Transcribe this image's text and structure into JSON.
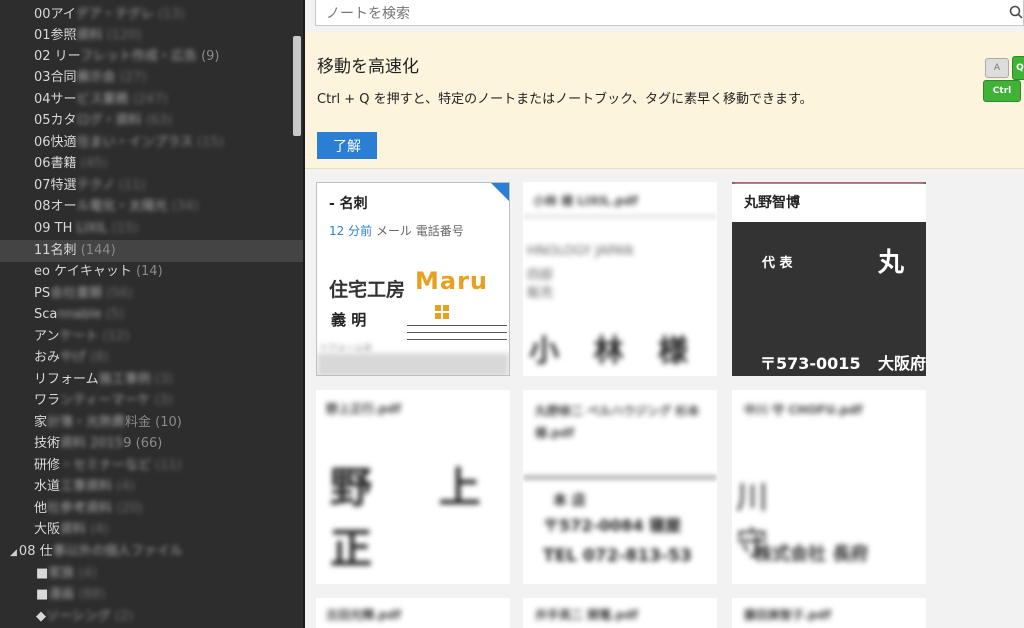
{
  "sidebar": {
    "items": [
      {
        "label": "00アイ",
        "blurred": "デア・テグレ",
        "count": "(13)"
      },
      {
        "label": "01参照",
        "blurred": "資料",
        "count": "(120)"
      },
      {
        "label": "02 リー",
        "blurred": "フレット作成・広告",
        "count": "(9)"
      },
      {
        "label": "03合同",
        "blurred": "展示会",
        "count": "(27)"
      },
      {
        "label": "04サー",
        "blurred": "ビス業務",
        "count": "(247)"
      },
      {
        "label": "05カタ",
        "blurred": "ログ・資料",
        "count": "(63)"
      },
      {
        "label": "06快適",
        "blurred": "住まい・インプラス",
        "count": "(15)"
      },
      {
        "label": "06書籍",
        "blurred": "",
        "count": "(45)"
      },
      {
        "label": "07特選",
        "blurred": "テクノ",
        "count": "(11)"
      },
      {
        "label": "08オー",
        "blurred": "ル電化・太陽光",
        "count": "(34)"
      },
      {
        "label": "09 TH",
        "blurred": "LIXIL",
        "count": "(15)"
      },
      {
        "label": "11名刺",
        "blurred": "",
        "count": "(144)"
      },
      {
        "label": "eo ケイキャット",
        "blurred": "",
        "count": "(14)"
      },
      {
        "label": "PS",
        "blurred": "会社書類",
        "count": "(56)"
      },
      {
        "label": "Sca",
        "blurred": "nnable",
        "count": "(5)"
      },
      {
        "label": "アン",
        "blurred": "ケート",
        "count": "(12)"
      },
      {
        "label": "おみ",
        "blurred": "やげ",
        "count": "(8)"
      },
      {
        "label": "リフォーム",
        "blurred": "施工事例",
        "count": "(3)"
      },
      {
        "label": "ワラ",
        "blurred": "ンティーマーケ",
        "count": "(3)"
      },
      {
        "label": "家",
        "blurred": "計簿・光熱費",
        "count": "料金 (10)"
      },
      {
        "label": "技術",
        "blurred": "資料 2015",
        "count": "9 (66)"
      },
      {
        "label": "研修",
        "blurred": "・セミナーなど",
        "count": "(11)"
      },
      {
        "label": "水道",
        "blurred": "工事資料",
        "count": "(4)"
      },
      {
        "label": "他",
        "blurred": "社参考資料",
        "count": "(20)"
      },
      {
        "label": "大阪",
        "blurred": "資料",
        "count": "(4)"
      }
    ],
    "group": "08 仕",
    "group_blurred": "事以外の個人ファイル",
    "subitems": [
      {
        "label": "■",
        "blurred": "家族",
        "count": "(4)"
      },
      {
        "label": "■",
        "blurred": "漫画",
        "count": "(88)"
      },
      {
        "label": "◆",
        "blurred": "ソーシング",
        "count": "(2)"
      }
    ]
  },
  "search": {
    "placeholder": "ノートを検索"
  },
  "tip": {
    "title": "移動を高速化",
    "body": "Ctrl + Q を押すと、特定のノートまたはノートブック、タグに素早く移動できます。",
    "ok": "了解",
    "keys": {
      "k1": "A",
      "k2": "Q",
      "k3": "Ctrl"
    }
  },
  "cards": [
    {
      "title": "- 名刺",
      "time": "12 分前",
      "snippet": "メール 電話番号",
      "body1": "住宅工房",
      "brand": "Maru",
      "name": "義 明",
      "note": "リフォームを"
    },
    {
      "title": "小林 様 LIXIL.pdf",
      "line1": "HNOLOGY JAPAN",
      "line2": "四部",
      "line3": "販売",
      "big": "小 林 様"
    },
    {
      "title": "丸野智博",
      "role": "代 表",
      "big": "丸",
      "zip": "〒573-0015",
      "city": "大阪府"
    },
    {
      "title": "野上正行.pdf",
      "big": "野 上 正"
    },
    {
      "title": "丸野修二 ベルハウジング 杉本様.pdf",
      "line1": "本 店",
      "line2": "〒572-0084 寝屋",
      "line3": "TEL 072-813-53"
    },
    {
      "title": "中川 守 CHOFU.pdf",
      "big": "川 守",
      "company": "株式会社 長府"
    },
    {
      "title": "古田光輝.pdf"
    },
    {
      "title": "井手英二 関電.pdf"
    },
    {
      "title": "藤田美智子.pdf"
    }
  ],
  "colors": {
    "accent": "#2a7ed4",
    "tip_bg": "#fcf4dc",
    "sidebar_bg": "#2d2d2d",
    "selected_bg": "#444444"
  }
}
